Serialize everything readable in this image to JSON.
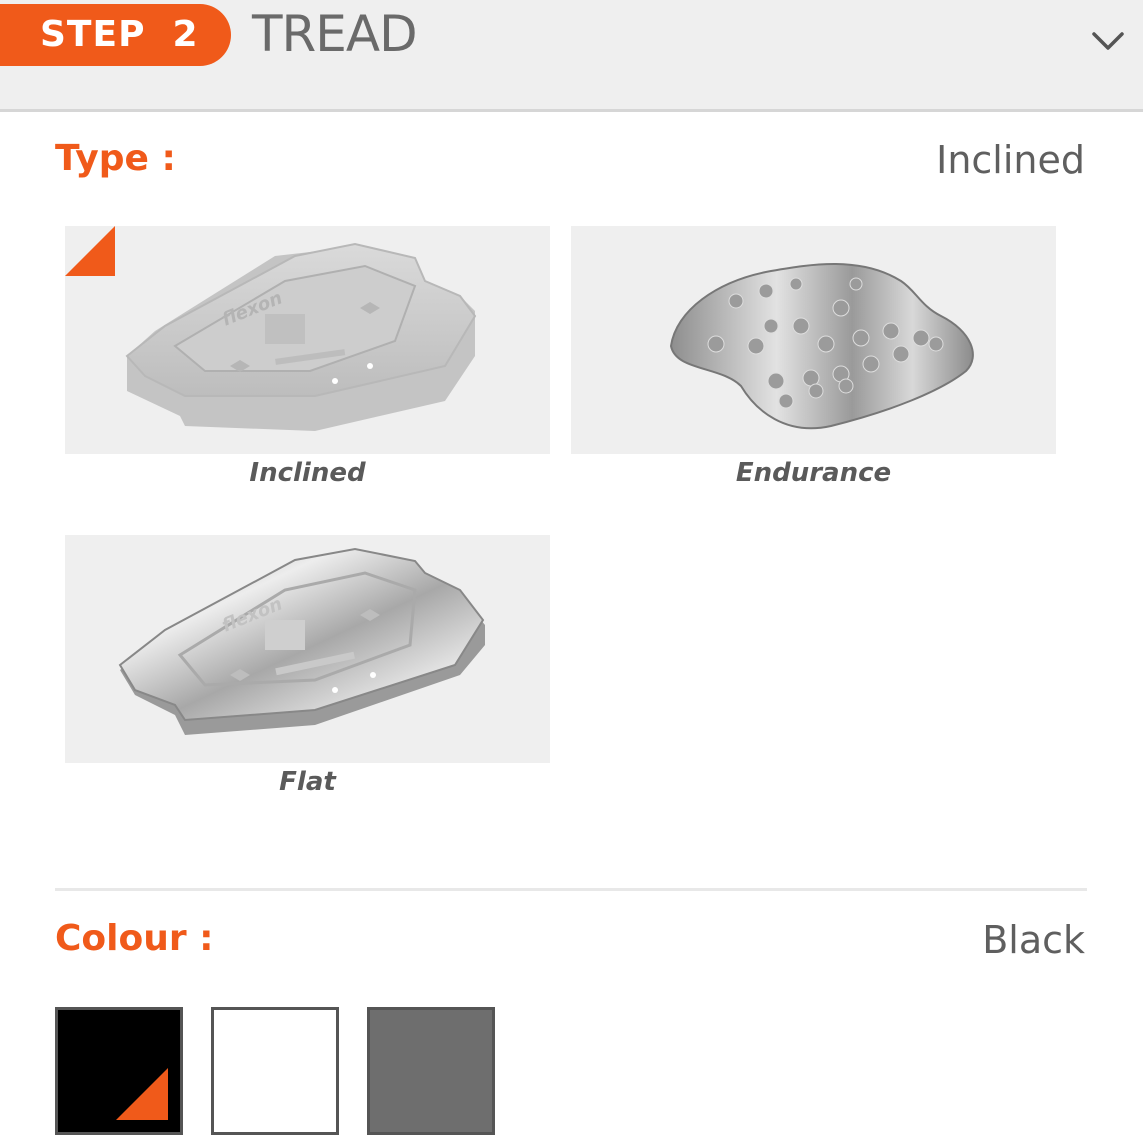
{
  "header": {
    "step_label": "STEP  2",
    "title": "TREAD",
    "expand_icon": "chevron-down-icon"
  },
  "type_section": {
    "label": "Type :",
    "selected_value": "Inclined",
    "options": [
      {
        "label": "Inclined",
        "selected": true
      },
      {
        "label": "Endurance",
        "selected": false
      },
      {
        "label": "Flat",
        "selected": false
      }
    ]
  },
  "colour_section": {
    "label": "Colour :",
    "selected_value": "Black",
    "swatches": [
      {
        "color": "#000000",
        "selected": true
      },
      {
        "color": "#ffffff",
        "selected": false
      },
      {
        "color": "#6e6e6e",
        "selected": false
      }
    ]
  },
  "colors": {
    "accent": "#f05a1a",
    "header_bg": "#efefef",
    "text_gray": "#5f5f5f"
  }
}
